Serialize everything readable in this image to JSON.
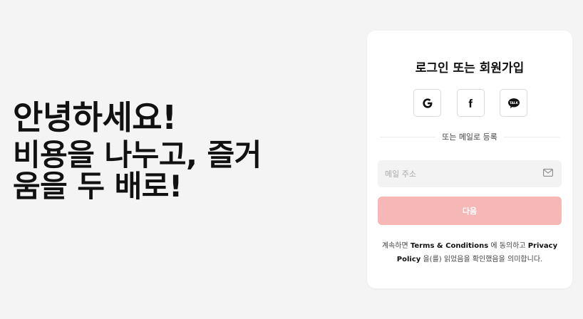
{
  "hero": {
    "line1": "안녕하세요!",
    "line2a": "비용을 나누고, 즐거",
    "line2b": "움을 두 배로!"
  },
  "card": {
    "title": "로그인 또는 회원가입",
    "social": [
      {
        "name": "google",
        "icon": "google-icon"
      },
      {
        "name": "facebook",
        "icon": "facebook-icon"
      },
      {
        "name": "kakao",
        "icon": "kakaotalk-icon",
        "badge": "TALK"
      }
    ],
    "divider_label": "또는 메일로 등록",
    "email_placeholder": "메일 주소",
    "next_label": "다음",
    "terms": {
      "prefix": "계속하면 ",
      "terms_link": "Terms & Conditions",
      "middle": " 에 동의하고 ",
      "privacy_link": "Privacy Policy",
      "suffix": " 을(를) 읽었음을 확인했음을 의미합니다."
    }
  },
  "colors": {
    "background": "#f4f4f4",
    "card": "#ffffff",
    "next_button": "#f6b7b7",
    "input_bg": "#f3f3f3"
  }
}
